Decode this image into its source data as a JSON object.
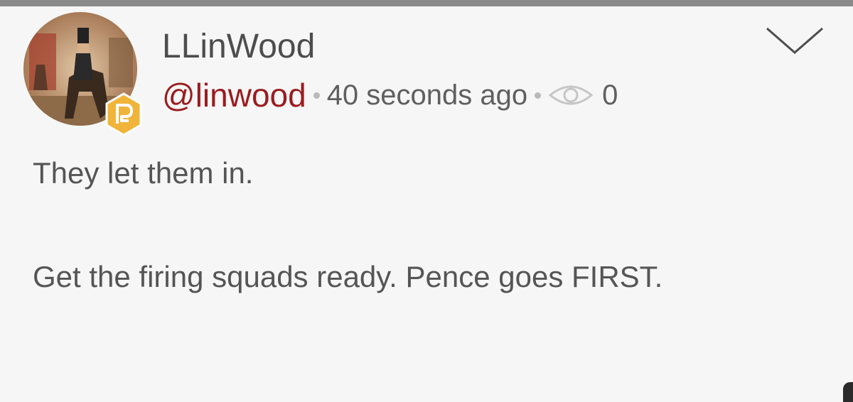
{
  "post": {
    "display_name": "LLinWood",
    "handle": "@linwood",
    "timestamp": "40 seconds ago",
    "view_count": "0",
    "body_lines": [
      "They let them in.",
      "Get the firing squads ready. Pence goes FIRST."
    ]
  },
  "icons": {
    "avatar": "avatar-image",
    "badge": "parler-badge-icon",
    "views": "eye-icon",
    "menu": "chevron-down-icon"
  },
  "colors": {
    "handle": "#9a1c1f",
    "badge": "#f0b43a",
    "text": "#555555",
    "background": "#f6f6f6"
  }
}
